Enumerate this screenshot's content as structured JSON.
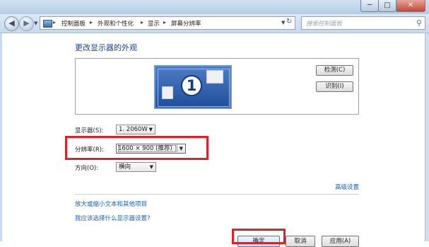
{
  "window": {
    "minimize_glyph": "─",
    "maximize_glyph": "□",
    "close_glyph": "✕"
  },
  "addressbar": {
    "back_glyph": "◀",
    "forward_glyph": "▶",
    "drop_glyph": "▼",
    "breadcrumb": [
      "控制面板",
      "外观和个性化",
      "显示",
      "屏幕分辨率"
    ],
    "separator_glyph": "▸",
    "refresh_glyph": "↻",
    "search_placeholder": "搜索控制面板",
    "search_glyph": "⚲"
  },
  "main": {
    "title": "更改显示器的外观",
    "monitor_number": "1",
    "detect_label": "检测(C)",
    "identify_label": "识别(I)",
    "display_label": "显示器(S):",
    "display_value": "1. 2060W",
    "resolution_label": "分辨率(R):",
    "resolution_value": "1600 × 900 (推荐)",
    "orientation_label": "方向(O):",
    "orientation_value": "横向",
    "advanced_link": "高级设置",
    "text_size_link": "放大或缩小文本和其他项目",
    "choose_link": "我应该选择什么显示器设置?",
    "ok_label": "确定",
    "cancel_label": "取消",
    "apply_label": "应用(A)",
    "dropdown_glyph": "▼"
  },
  "colors": {
    "highlight": "#d9232d",
    "link": "#1a5fb4",
    "title": "#1e3f8a"
  }
}
